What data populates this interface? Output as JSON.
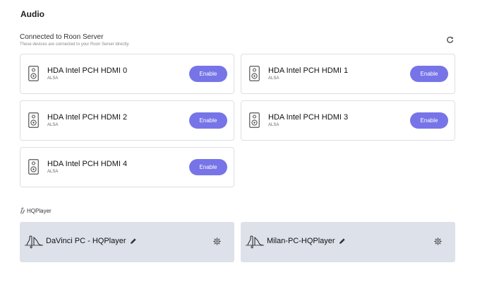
{
  "page": {
    "title": "Audio"
  },
  "connected": {
    "title": "Connected to Roon Server",
    "subtitle": "These devices are connected to your Roon Server directly."
  },
  "devices": [
    {
      "name": "HDA Intel PCH HDMI 0",
      "type": "ALSA",
      "button": "Enable"
    },
    {
      "name": "HDA Intel PCH HDMI 1",
      "type": "ALSA",
      "button": "Enable"
    },
    {
      "name": "HDA Intel PCH HDMI 2",
      "type": "ALSA",
      "button": "Enable"
    },
    {
      "name": "HDA Intel PCH HDMI 3",
      "type": "ALSA",
      "button": "Enable"
    },
    {
      "name": "HDA Intel PCH HDMI 4",
      "type": "ALSA",
      "button": "Enable"
    }
  ],
  "hqplayer": {
    "label": "HQPlayer",
    "instances": [
      {
        "name": "DaVinci PC - HQPlayer"
      },
      {
        "name": "Milan-PC-HQPlayer"
      }
    ]
  },
  "icons": {
    "refresh": "refresh-icon",
    "speaker": "speaker-icon",
    "hqplayer": "hqplayer-icon",
    "pencil": "pencil-icon",
    "gear": "gear-icon"
  },
  "colors": {
    "accent": "#7774e8",
    "hq_card_bg": "#dde1ea",
    "card_border": "#dcdfe4"
  }
}
